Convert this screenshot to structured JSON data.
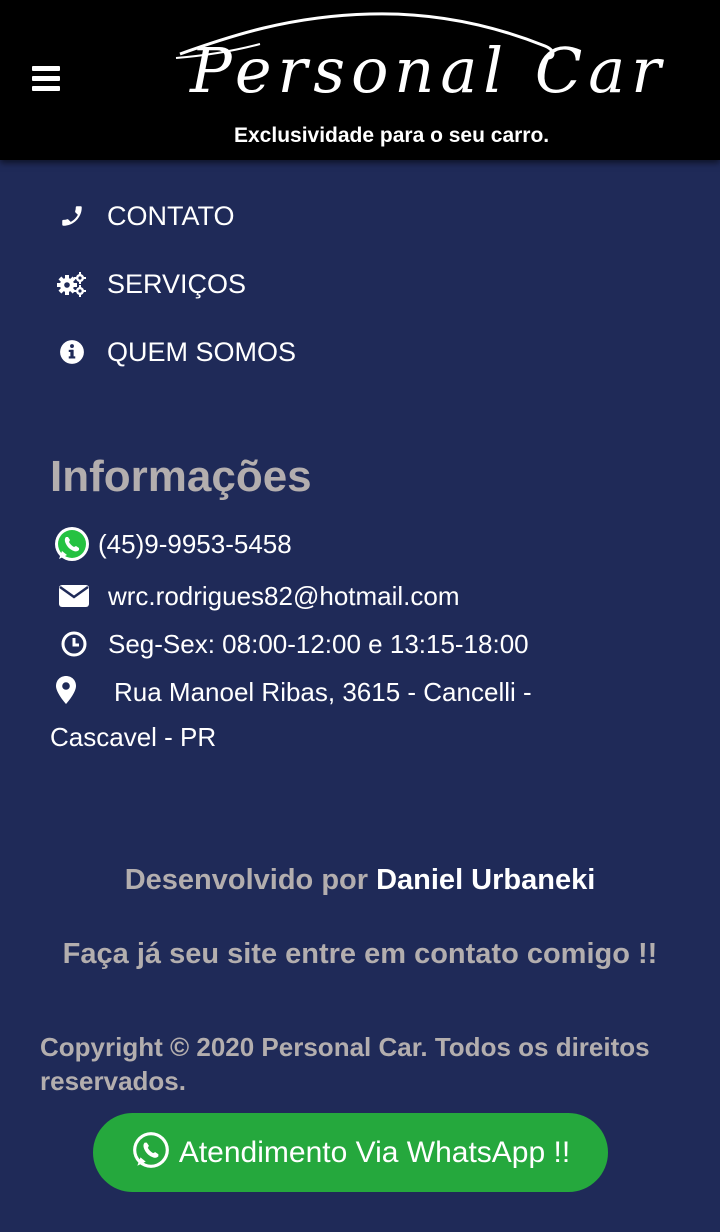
{
  "header": {
    "menu_icon": "hamburger-menu-icon",
    "logo": {
      "title": "Personal Car",
      "tagline": "Exclusividade para o seu carro."
    }
  },
  "nav": {
    "items": [
      {
        "label": "CONTATO",
        "icon": "phone-icon"
      },
      {
        "label": "SERVIÇOS",
        "icon": "gears-icon"
      },
      {
        "label": "QUEM SOMOS",
        "icon": "info-circle-icon"
      }
    ]
  },
  "info": {
    "title": "Informações",
    "phone": "(45)9-9953-5458",
    "email": "wrc.rodrigues82@hotmail.com",
    "hours": "Seg-Sex: 08:00-12:00 e 13:15-18:00",
    "address": "Rua Manoel Ribas, 3615 - Cancelli - Cascavel - PR"
  },
  "footer": {
    "developed_by_prefix": "Desenvolvido por",
    "developer_name": "Daniel Urbaneki",
    "cta": "Faça já seu site entre em contato comigo !!",
    "copyright": "Copyright © 2020 Personal Car. Todos os direitos reservados."
  },
  "whatsapp_button": {
    "label": "Atendimento Via WhatsApp !!"
  },
  "colors": {
    "background": "#1f2a58",
    "header": "#000000",
    "muted_text": "#b3aeae",
    "whatsapp_green": "#25a83d"
  }
}
